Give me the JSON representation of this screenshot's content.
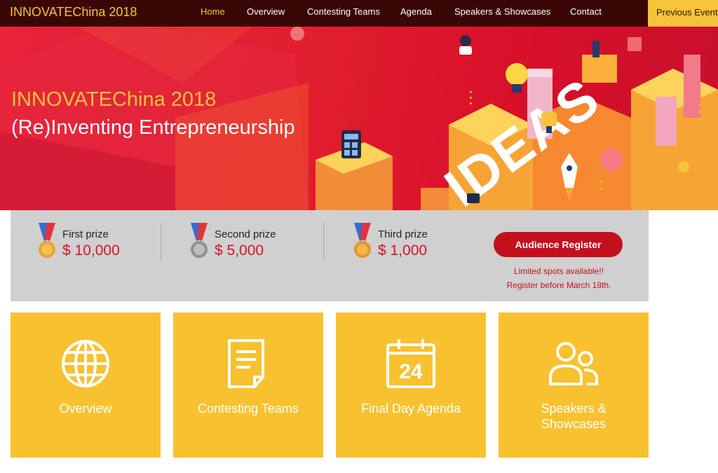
{
  "nav": {
    "brand": "INNOVATEChina 2018",
    "items": [
      {
        "label": "Home",
        "active": true
      },
      {
        "label": "Overview",
        "active": false
      },
      {
        "label": "Contesting Teams",
        "active": false
      },
      {
        "label": "Agenda",
        "active": false
      },
      {
        "label": "Speakers & Showcases",
        "active": false
      },
      {
        "label": "Contact",
        "active": false
      }
    ],
    "previous_events": "Previous Events"
  },
  "hero": {
    "title": "INNOVATEChina 2018",
    "subtitle": "(Re)Inventing Entrepreneurship",
    "illustration_text": "IDEAS",
    "calculator_icon": "calculator-icon",
    "lightbulb_icon": "lightbulb-icon",
    "trophy_icon": "trophy-icon",
    "rocket_icon": "rocket-icon"
  },
  "prizes": [
    {
      "label": "First prize",
      "amount": "$ 10,000",
      "medal_icon": "gold-medal-icon",
      "medal_color": "#e8a233"
    },
    {
      "label": "Second prize",
      "amount": "$ 5,000",
      "medal_icon": "silver-medal-icon",
      "medal_color": "#9a9a9a"
    },
    {
      "label": "Third prize",
      "amount": "$ 1,000",
      "medal_icon": "bronze-medal-icon",
      "medal_color": "#e0952b"
    }
  ],
  "register": {
    "button_label": "Audience Register",
    "note_line1": "Limited spots available!!",
    "note_line2": "Register before March 18th."
  },
  "tiles": [
    {
      "label": "Overview",
      "icon": "globe-icon"
    },
    {
      "label": "Contesting Teams",
      "icon": "document-icon"
    },
    {
      "label": "Final Day Agenda",
      "icon": "calendar-icon",
      "icon_text": "24"
    },
    {
      "label_line1": "Speakers &",
      "label_line2": "Showcases",
      "icon": "people-icon"
    }
  ],
  "colors": {
    "nav_bg": "#3a0707",
    "accent_yellow": "#f7c33a",
    "hero_red": "#e21f2f",
    "register_red": "#c4101e",
    "tile_yellow": "#f8c12f",
    "prize_bar_gray": "#d0d0d0"
  }
}
